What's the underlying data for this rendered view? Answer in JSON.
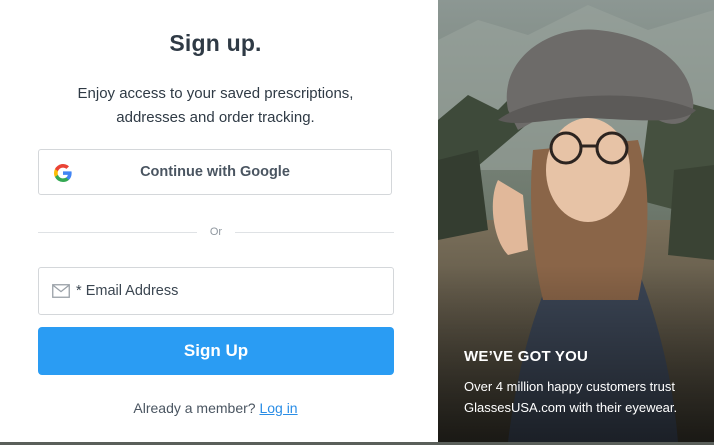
{
  "header": {
    "title": "Sign up.",
    "subtitle": "Enjoy access to your saved prescriptions, addresses and order tracking."
  },
  "google_button": {
    "label": "Continue with Google",
    "icon": "google-g-icon"
  },
  "divider": {
    "text": "Or"
  },
  "email_field": {
    "required_mark": "*",
    "placeholder": "Email Address",
    "value": "",
    "icon": "mail-icon"
  },
  "signup_button": {
    "label": "Sign Up"
  },
  "member_prompt": {
    "text": "Already a member?",
    "link": "Log in"
  },
  "promo": {
    "title": "WE’VE GOT YOU",
    "text": "Over 4 million happy customers trust GlassesUSA.com with their eyewear."
  },
  "colors": {
    "primary": "#2a9cf3",
    "link": "#2a8de6",
    "text": "#2f3a45"
  }
}
